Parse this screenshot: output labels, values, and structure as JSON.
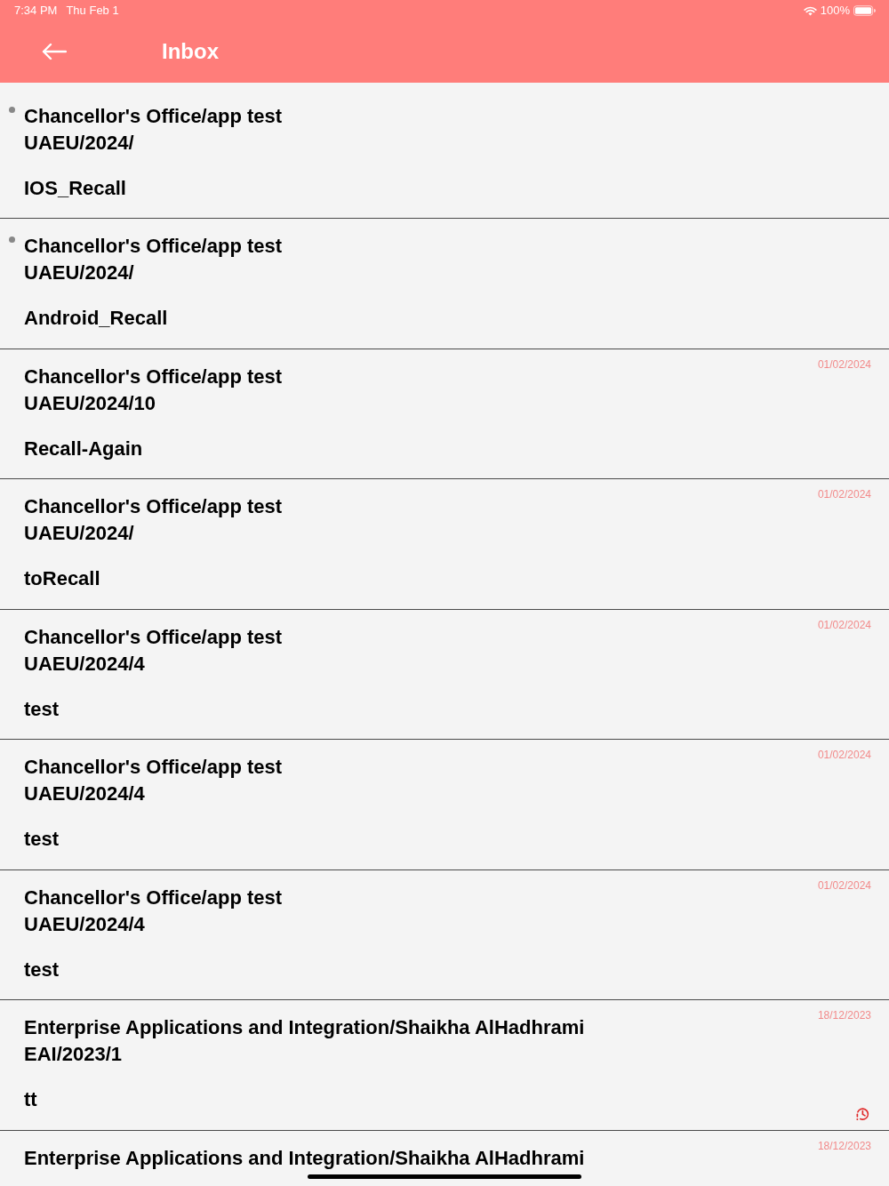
{
  "status_bar": {
    "time": "7:34 PM",
    "date": "Thu Feb 1",
    "battery": "100%"
  },
  "header": {
    "title": "Inbox"
  },
  "messages": [
    {
      "sender": "Chancellor's Office/app test",
      "reference": "UAEU/2024/",
      "subject": "IOS_Recall",
      "unread": true,
      "reminder": false
    },
    {
      "sender": "Chancellor's Office/app test",
      "reference": "UAEU/2024/",
      "subject": "Android_Recall",
      "unread": true,
      "reminder": false
    },
    {
      "sender": "Chancellor's Office/app test",
      "reference": "UAEU/2024/10",
      "subject": "Recall-Again",
      "date": "01/02/2024",
      "unread": false,
      "reminder": false
    },
    {
      "sender": "Chancellor's Office/app test",
      "reference": "UAEU/2024/",
      "subject": "toRecall",
      "date": "01/02/2024",
      "unread": false,
      "reminder": false
    },
    {
      "sender": "Chancellor's Office/app test",
      "reference": "UAEU/2024/4",
      "subject": "test",
      "date": "01/02/2024",
      "unread": false,
      "reminder": false
    },
    {
      "sender": "Chancellor's Office/app test",
      "reference": "UAEU/2024/4",
      "subject": "test",
      "date": "01/02/2024",
      "unread": false,
      "reminder": false
    },
    {
      "sender": "Chancellor's Office/app test",
      "reference": "UAEU/2024/4",
      "subject": "test",
      "date": "01/02/2024",
      "unread": false,
      "reminder": false
    },
    {
      "sender": "Enterprise Applications and Integration/Shaikha AlHadhrami",
      "reference": "EAI/2023/1",
      "subject": "tt",
      "date": "18/12/2023",
      "unread": false,
      "reminder": true
    },
    {
      "sender": "Enterprise Applications and Integration/Shaikha AlHadhrami",
      "date": "18/12/2023",
      "unread": false,
      "reminder": false
    }
  ]
}
